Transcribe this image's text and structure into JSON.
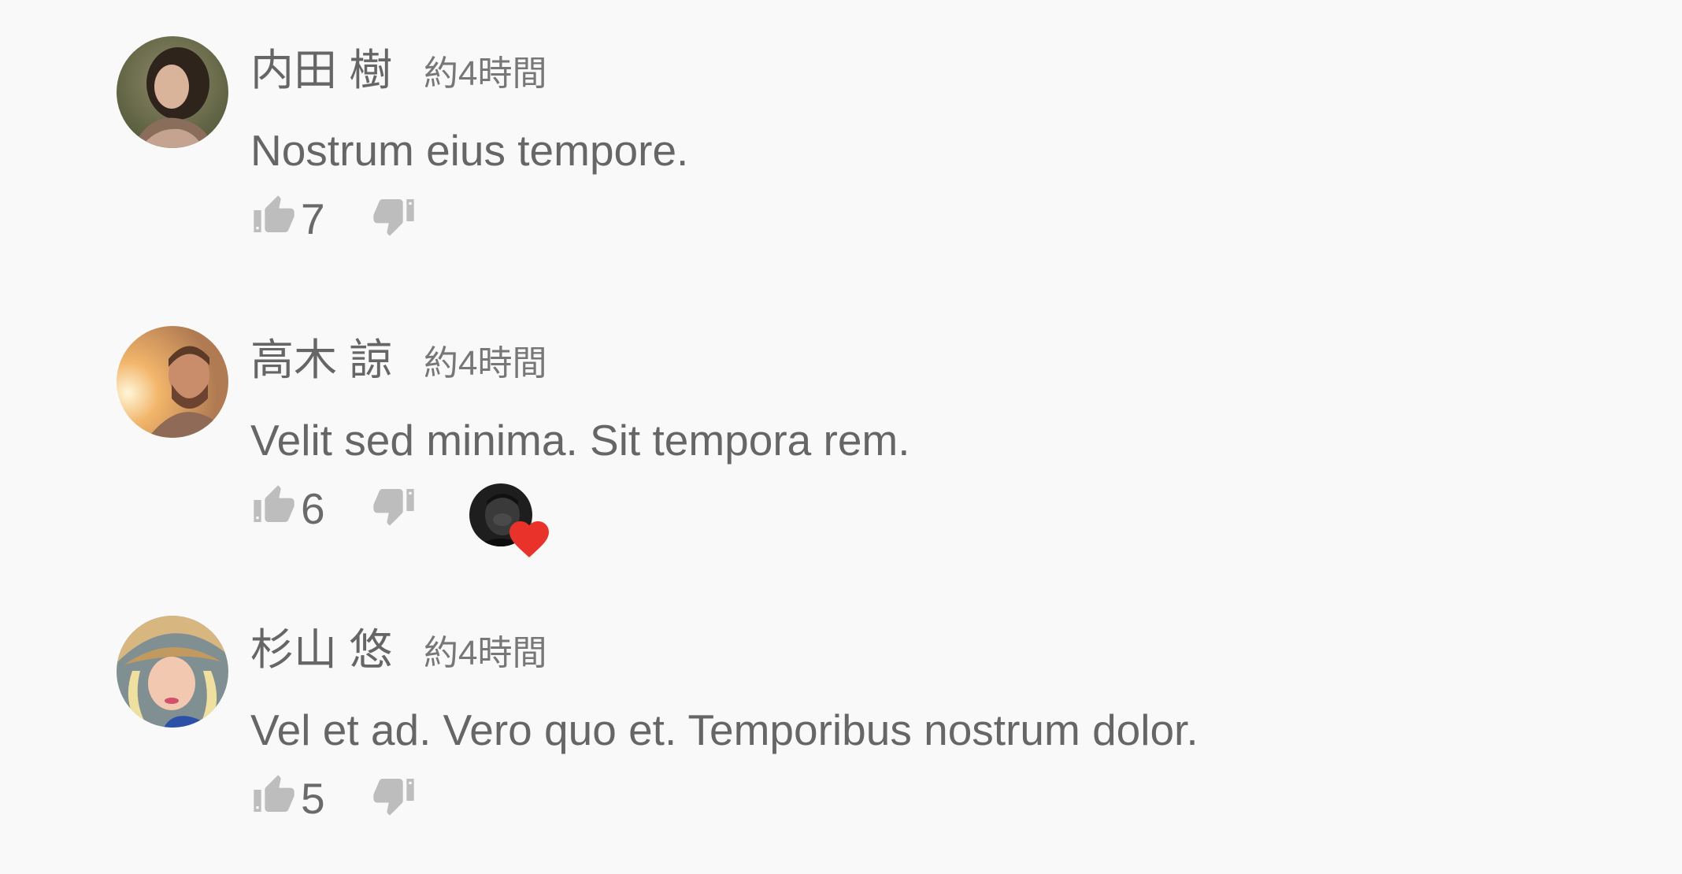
{
  "comments": [
    {
      "author": "内田 樹",
      "time": "約4時間",
      "text": "Nostrum eius tempore.",
      "likes": "7",
      "hearted": false
    },
    {
      "author": "高木 諒",
      "time": "約4時間",
      "text": "Velit sed minima. Sit tempora rem.",
      "likes": "6",
      "hearted": true
    },
    {
      "author": "杉山 悠",
      "time": "約4時間",
      "text": "Vel et ad. Vero quo et. Temporibus nostrum dolor.",
      "likes": "5",
      "hearted": false
    }
  ],
  "icons": {
    "like": "thumbs-up-icon",
    "dislike": "thumbs-down-icon",
    "heart": "heart-icon"
  },
  "colors": {
    "background": "#f9f9f9",
    "text": "#666666",
    "icon": "#bdbdbd",
    "heart": "#e8322a"
  }
}
